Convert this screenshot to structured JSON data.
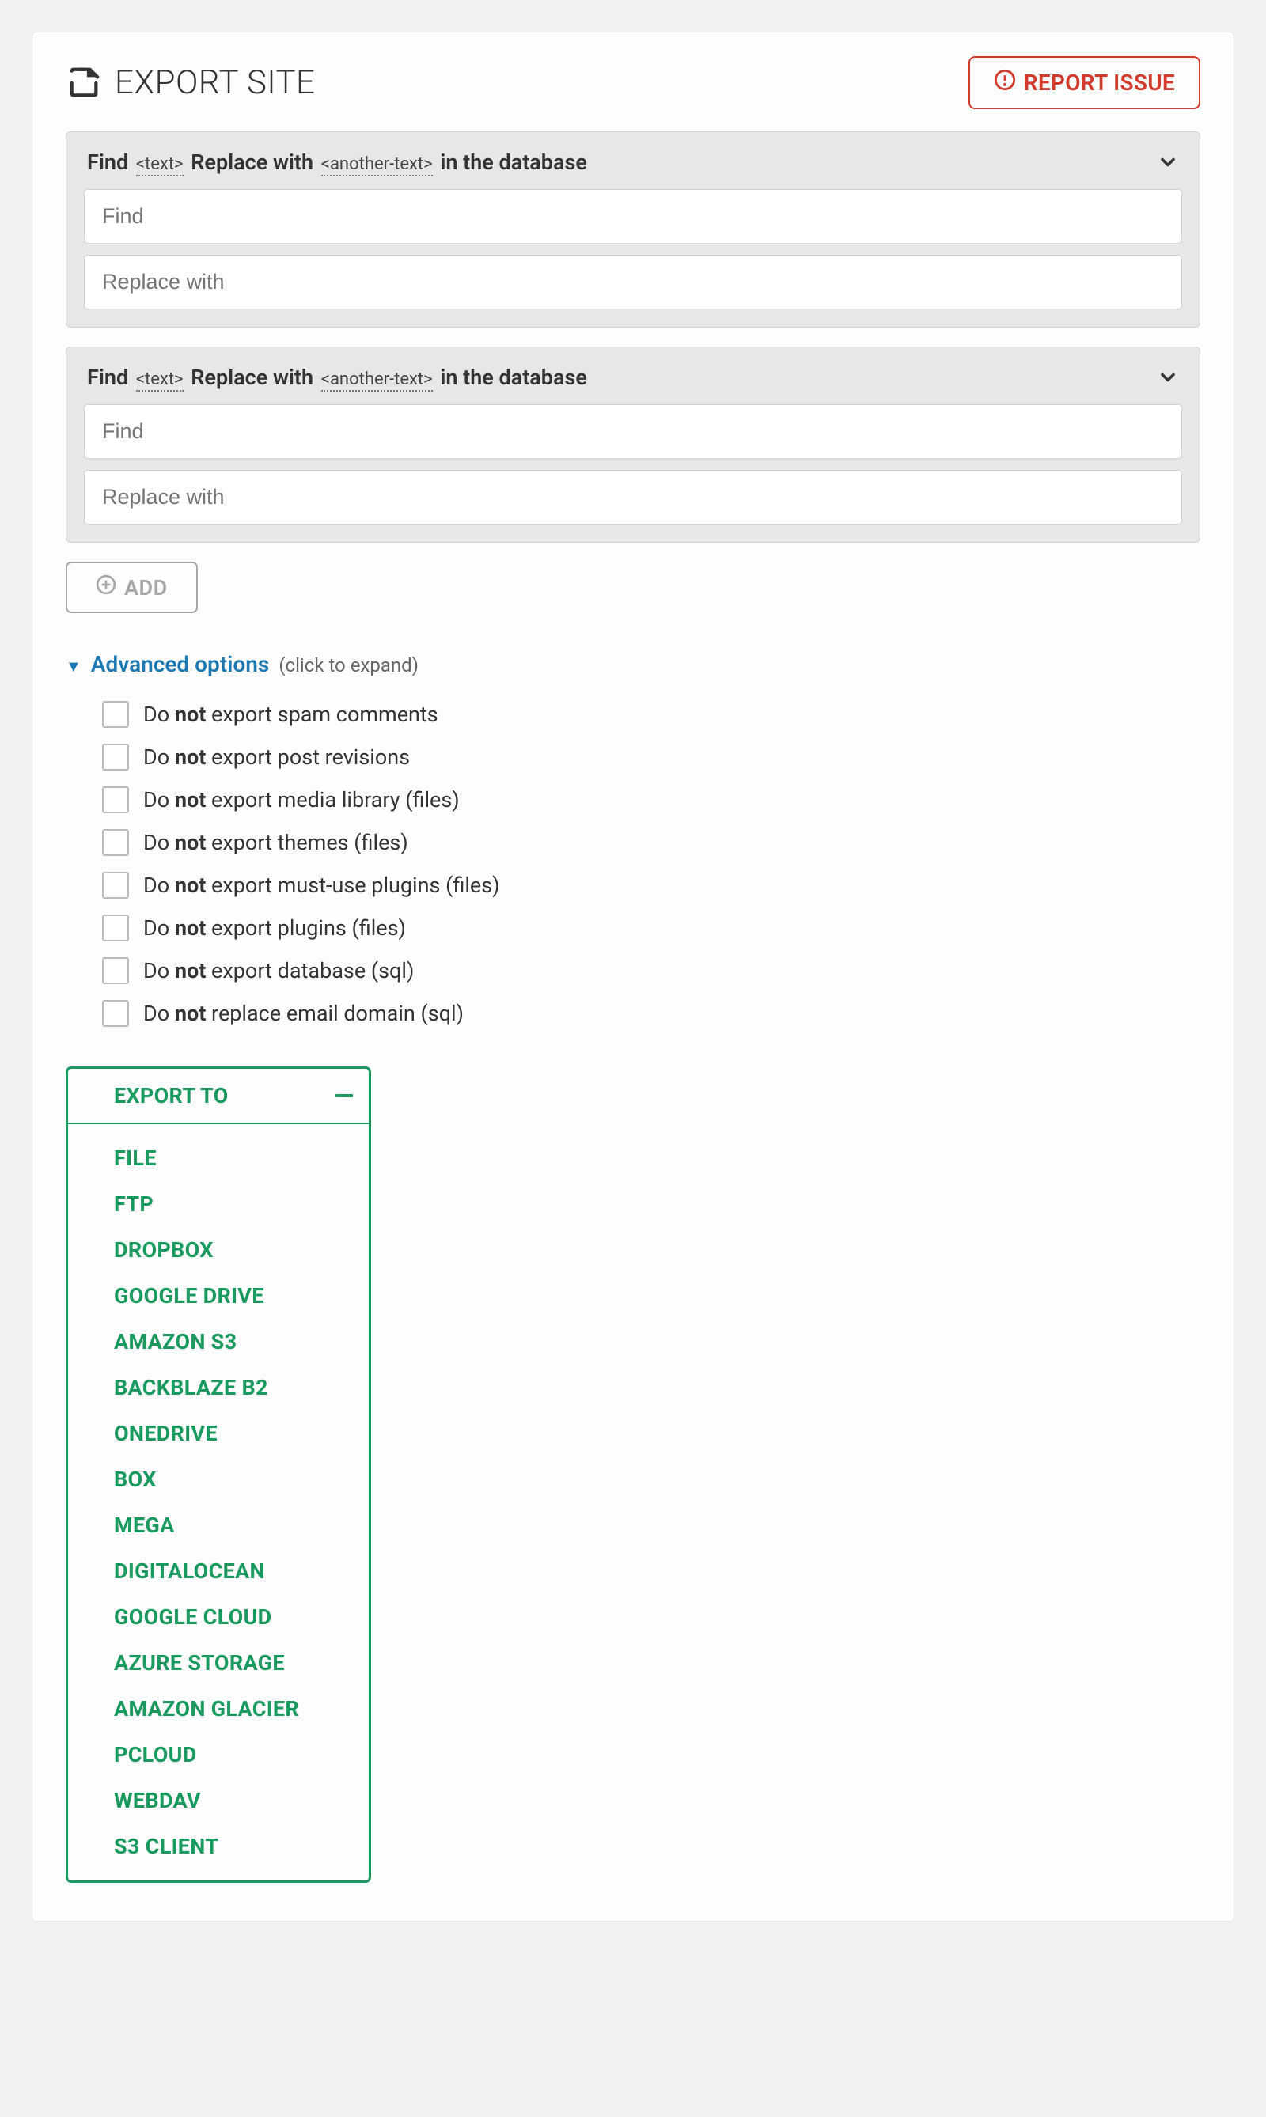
{
  "header": {
    "title": "EXPORT SITE",
    "report_label": "REPORT ISSUE"
  },
  "find_replace": {
    "header_prefix": "Find",
    "header_tag1": "<text>",
    "header_mid": "Replace with",
    "header_tag2": "<another-text>",
    "header_suffix": "in the database",
    "find_placeholder": "Find",
    "replace_placeholder": "Replace with"
  },
  "buttons": {
    "add": "ADD"
  },
  "advanced": {
    "label": "Advanced options",
    "hint": "(click to expand)",
    "options": [
      {
        "pre": "Do ",
        "bold": "not",
        "post": " export spam comments"
      },
      {
        "pre": "Do ",
        "bold": "not",
        "post": " export post revisions"
      },
      {
        "pre": "Do ",
        "bold": "not",
        "post": " export media library (files)"
      },
      {
        "pre": "Do ",
        "bold": "not",
        "post": " export themes (files)"
      },
      {
        "pre": "Do ",
        "bold": "not",
        "post": " export must-use plugins (files)"
      },
      {
        "pre": "Do ",
        "bold": "not",
        "post": " export plugins (files)"
      },
      {
        "pre": "Do ",
        "bold": "not",
        "post": " export database (sql)"
      },
      {
        "pre": "Do ",
        "bold": "not",
        "post": " replace email domain (sql)"
      }
    ]
  },
  "export": {
    "header": "EXPORT TO",
    "items": [
      "FILE",
      "FTP",
      "DROPBOX",
      "GOOGLE DRIVE",
      "AMAZON S3",
      "BACKBLAZE B2",
      "ONEDRIVE",
      "BOX",
      "MEGA",
      "DIGITALOCEAN",
      "GOOGLE CLOUD",
      "AZURE STORAGE",
      "AMAZON GLACIER",
      "PCLOUD",
      "WEBDAV",
      "S3 CLIENT"
    ]
  }
}
